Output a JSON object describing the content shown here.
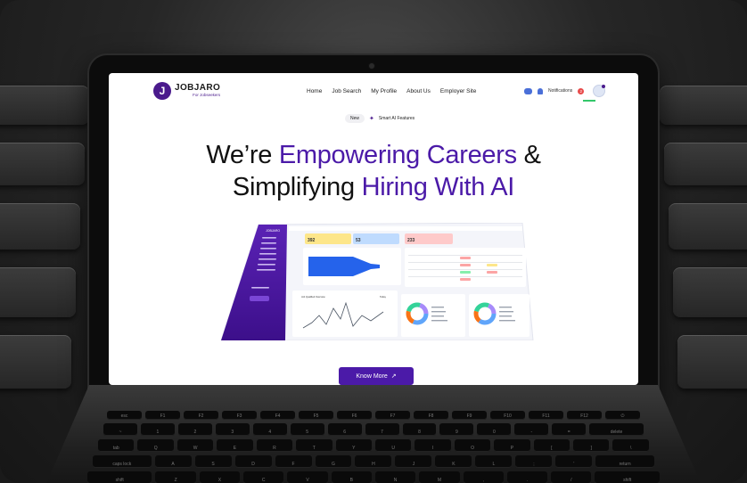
{
  "brand": {
    "name": "JOBJARO",
    "tagline": "For Jobseekers",
    "mark": "J",
    "color": "#4a1a8c"
  },
  "nav": {
    "items": [
      "Home",
      "Job Search",
      "My Profile",
      "About Us",
      "Employer Site"
    ],
    "notifications_label": "Notifications",
    "notifications_count": "2"
  },
  "hero": {
    "badge": "New",
    "badge_text": "Smart AI Features",
    "line1_a": "We’re ",
    "line1_b": "Empowering Careers",
    "line1_c": " &",
    "line2_a": "Simplifying ",
    "line2_b": "Hiring With AI",
    "highlight_color": "#4b1aa8"
  },
  "dashboard": {
    "logo": "JOBJARO",
    "stats": [
      "392",
      "53",
      "233"
    ],
    "chart_title": "Job Qualified Overview",
    "filter": "Today"
  },
  "cta": {
    "label": "Know More",
    "icon": "arrow-up-right-icon"
  },
  "keyboard": {
    "row1": [
      "esc",
      "F1",
      "F2",
      "F3",
      "F4",
      "F5",
      "F6",
      "F7",
      "F8",
      "F9",
      "F10",
      "F11",
      "F12",
      "⏻"
    ],
    "row2": [
      "~",
      "1",
      "2",
      "3",
      "4",
      "5",
      "6",
      "7",
      "8",
      "9",
      "0",
      "-",
      "=",
      "delete"
    ],
    "row3": [
      "tab",
      "Q",
      "W",
      "E",
      "R",
      "T",
      "Y",
      "U",
      "I",
      "O",
      "P",
      "[",
      "]",
      "\\"
    ],
    "row4": [
      "caps lock",
      "A",
      "S",
      "D",
      "F",
      "G",
      "H",
      "J",
      "K",
      "L",
      ";",
      "'",
      "return"
    ],
    "row5": [
      "shift",
      "Z",
      "X",
      "C",
      "V",
      "B",
      "N",
      "M",
      ",",
      ".",
      "/",
      "shift"
    ],
    "row6": [
      "fn",
      "control",
      "option",
      "command",
      "",
      "command",
      "option"
    ]
  }
}
